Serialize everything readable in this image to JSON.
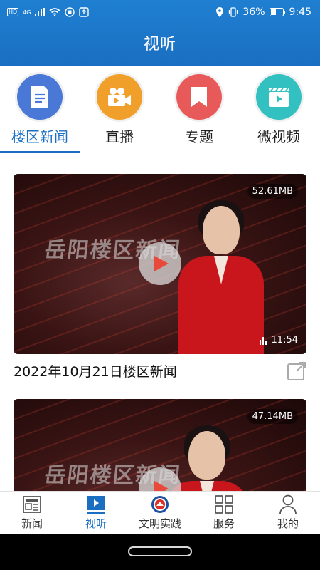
{
  "status_bar": {
    "hd": "HD",
    "network": "4G",
    "battery": "36%",
    "time": "9:45"
  },
  "header": {
    "title": "视听"
  },
  "categories": [
    {
      "label": "楼区新闻",
      "icon": "document-icon",
      "color": "#4a78d6",
      "active": true
    },
    {
      "label": "直播",
      "icon": "video-camera-icon",
      "color": "#f0a02a",
      "active": false
    },
    {
      "label": "专题",
      "icon": "bookmark-icon",
      "color": "#e85a5a",
      "active": false
    },
    {
      "label": "微视频",
      "icon": "clapperboard-icon",
      "color": "#32c0c0",
      "active": false
    }
  ],
  "videos": [
    {
      "watermark": "岳阳楼区新闻",
      "size": "52.61MB",
      "duration": "11:54",
      "title": "2022年10月21日楼区新闻"
    },
    {
      "watermark": "岳阳楼区新闻",
      "size": "47.14MB",
      "duration": "",
      "title": ""
    }
  ],
  "tabbar": [
    {
      "label": "新闻",
      "icon": "newspaper-icon",
      "active": false
    },
    {
      "label": "视听",
      "icon": "video-play-icon",
      "active": true
    },
    {
      "label": "文明实践",
      "icon": "emblem-icon",
      "active": false
    },
    {
      "label": "服务",
      "icon": "grid-icon",
      "active": false
    },
    {
      "label": "我的",
      "icon": "user-icon",
      "active": false
    }
  ],
  "colors": {
    "primary": "#1a6fc2",
    "header": "#1f7fd1"
  }
}
